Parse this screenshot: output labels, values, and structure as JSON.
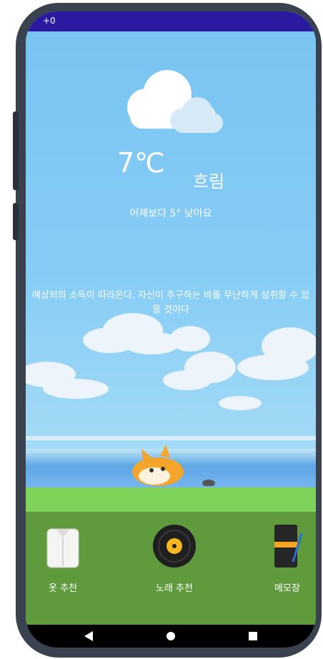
{
  "status": {
    "text": "+0"
  },
  "weather": {
    "icon": "cloud-icon",
    "temperature": "7℃",
    "condition": "흐림",
    "comparison": "어제보다 5° 낮아요"
  },
  "quote": {
    "text": "예상외의 소득이 따라온다. 자신이 추구하는 바를 무난하게 성취할 수 있을 것이다"
  },
  "menu": [
    {
      "label": "옷 추천",
      "icon": "shirt-icon"
    },
    {
      "label": "노래 추천",
      "icon": "vinyl-record-icon"
    },
    {
      "label": "메모장",
      "icon": "notebook-icon"
    }
  ],
  "navbar": {
    "back_icon": "back-icon",
    "home_icon": "home-icon",
    "recents_icon": "recents-icon"
  },
  "colors": {
    "status_bar": "#2a1aa0",
    "sky": "#7cc6f3",
    "ground": "#5f9a3d",
    "navbar": "#000000"
  }
}
